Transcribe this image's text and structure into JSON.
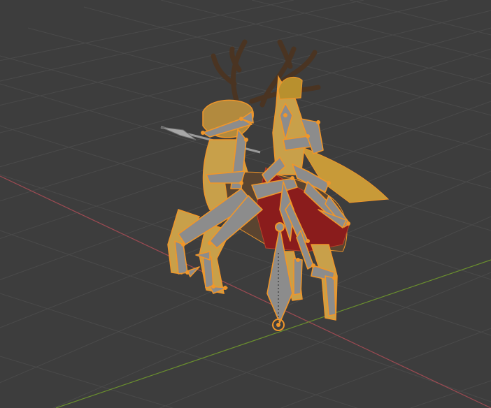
{
  "viewport": {
    "view": "perspective",
    "mode": "pose",
    "background_color": "#3d3d3d",
    "grid_color": "#4a4a4a",
    "x_axis_color": "#9c4a52",
    "y_axis_color": "#6a8f2e"
  },
  "scene": {
    "object": "armored-rider-on-stag",
    "armature": "visible",
    "selection_color": "#f0962a",
    "bone_color": "#8c8c8c",
    "armor_color": "#c8a04a",
    "cape_color": "#8a1c1c",
    "antler_color": "#4a3422"
  },
  "origin": {
    "icon": "object-origin-icon"
  }
}
